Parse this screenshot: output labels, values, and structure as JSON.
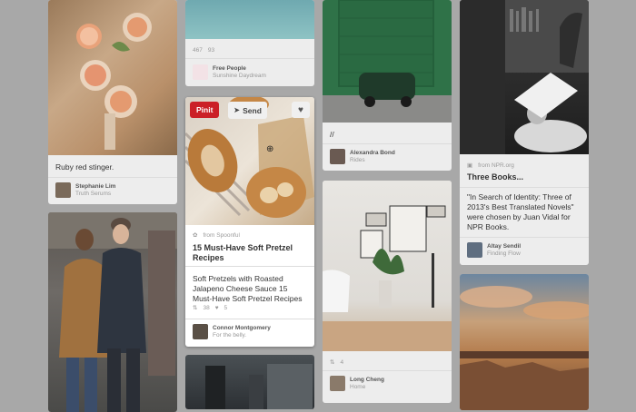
{
  "colors": {
    "pinit_red": "#cb2027",
    "bg": "#a8a8a8"
  },
  "col1": {
    "caption": "Ruby red stinger.",
    "user": {
      "name": "Stephanie Lim",
      "board": "Truth Serums"
    }
  },
  "col2": {
    "top": {
      "likes": "467",
      "repins": "93",
      "user": {
        "name": "Free People",
        "board": "Sunshine Daydream"
      }
    },
    "active": {
      "pinit_label": "Pinit",
      "send_label": "Send",
      "source": "from Spoonful",
      "title": "15 Must-Have Soft Pretzel Recipes",
      "description": "Soft Pretzels with Roasted Jalapeno Cheese Sauce 15 Must-Have Soft Pretzel Recipes",
      "likes": "38",
      "repins": "5",
      "user": {
        "name": "Connor Montgomery",
        "board": "For the belly."
      }
    }
  },
  "col3": {
    "top": {
      "caption": "//",
      "user": {
        "name": "Alexandra Bond",
        "board": "Rides"
      }
    },
    "bottom": {
      "likes": "4",
      "user": {
        "name": "Long Cheng",
        "board": "Home"
      }
    }
  },
  "col4": {
    "source": "from NPR.org",
    "title": "Three Books...",
    "description": "\"In Search of Identity: Three of 2013's Best Translated Novels\" were chosen by Juan Vidal for NPR Books.",
    "user": {
      "name": "Altay Sendil",
      "board": "Finding Flow"
    }
  }
}
